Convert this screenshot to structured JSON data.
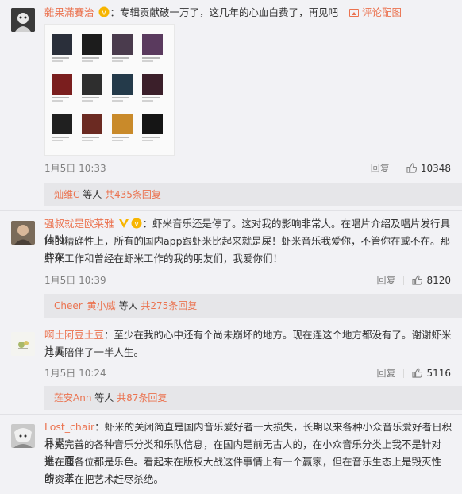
{
  "comments": [
    {
      "user": "雜果滿賽治",
      "separator": "：",
      "text": "专辑贡献破一万了，这几年的心血白费了，再见吧",
      "link": "评论配图",
      "time": "1月5日 10:33",
      "reply_label": "回复",
      "likes": "10348",
      "replies_user": "灿维C",
      "replies_mid": " 等人 ",
      "replies_count": "共435条回复"
    },
    {
      "user": "强叔就是欧莱雅",
      "separator": "：",
      "text_line1": "虾米音乐还是停了。这对我的影响非常大。在唱片介绍及唱片发行具体时",
      "text_line2": "间的精确性上，所有的国内app跟虾米比起来就是屎！虾米音乐我爱你，不管你在或不在。那些在",
      "text_line3": "虾米工作和曾经在虾米工作的我的朋友们，我爱你们！",
      "time": "1月5日 10:39",
      "reply_label": "回复",
      "likes": "8120",
      "replies_user": "Cheer_黄小威",
      "replies_mid": " 等人 ",
      "replies_count": "共275条回复"
    },
    {
      "user": "啊土阿豆土豆",
      "separator": "：",
      "text_line1": "至少在我的心中还有个尚未崩坏的地方。现在连这个地方都没有了。谢谢虾米让五",
      "text_line2": "月天陪伴了一半人生。",
      "time": "1月5日 10:24",
      "reply_label": "回复",
      "likes": "5116",
      "replies_user": "莲安Ann",
      "replies_mid": " 等人 ",
      "replies_count": "共87条回复"
    },
    {
      "user": "Lost_chair",
      "separator": "：",
      "text_line1": "虾米的关闭简直是国内音乐爱好者一大损失，长期以来各种小众音乐爱好者日积月累",
      "text_line2": "补充完善的各种音乐分类和乐队信息，在国内是前无古人的，在小众音乐分类上我不是针对谁，而",
      "text_line3": "是在座各位都是乐色。看起来在版权大战这件事情上有一个赢家，但在音乐生态上是毁灭性的，垄",
      "text_line4": "断资本在把艺术赶尽杀绝。"
    }
  ],
  "colors": {
    "accent": "#eb7350",
    "background": "#f2f2f5",
    "reply_bar": "#e6e6e9",
    "meta": "#808080"
  },
  "icons": [
    "vip-badge-icon",
    "picture-icon",
    "thumbs-up-icon",
    "verified-v-icon"
  ]
}
